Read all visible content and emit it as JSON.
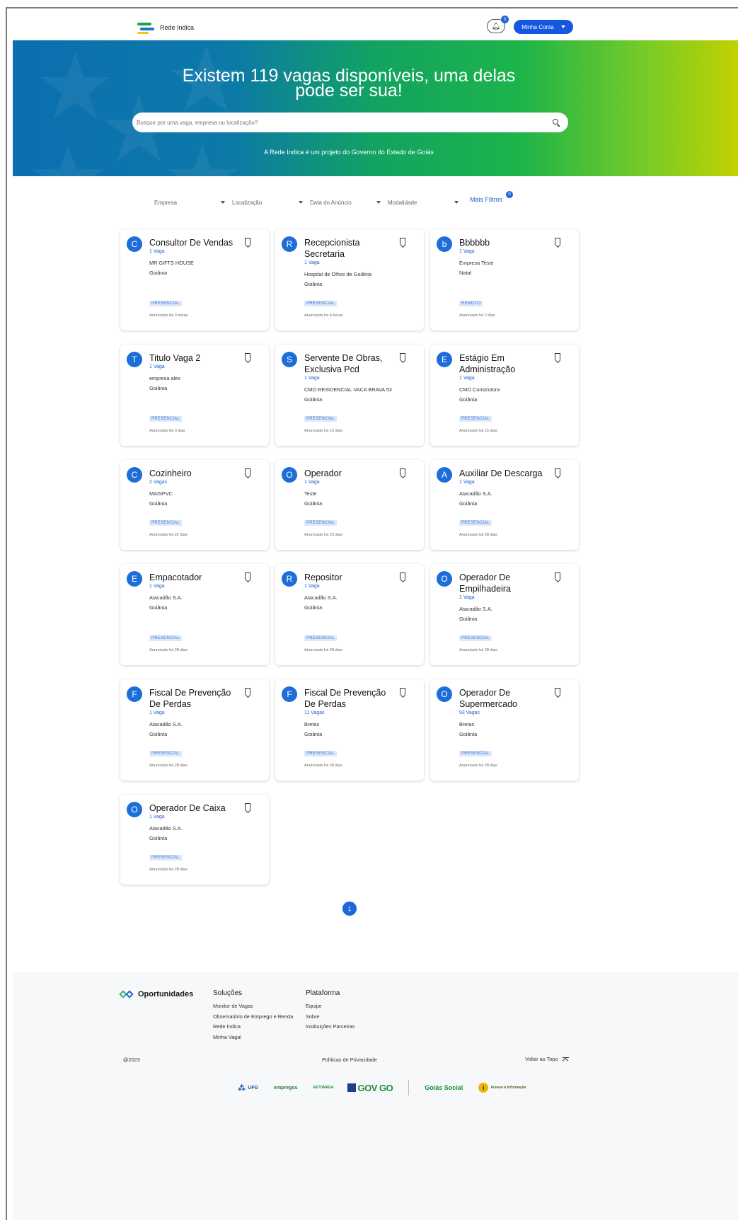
{
  "header": {
    "logo_text": "Rede Indica",
    "notif_count": "0",
    "account_label": "Minha Conta"
  },
  "hero": {
    "title_line1": "Existem 119 vagas disponíveis, uma delas",
    "title_line2": "pode ser sua!",
    "search_placeholder": "Busque por uma vaga, empresa ou localização?",
    "subtitle": "A Rede Indica é um projeto do Governo do Estado de Goiás"
  },
  "filters": {
    "items": [
      "Empresa",
      "Localização",
      "Data do Anúncio",
      "Modalidade"
    ],
    "more_label": "Mais Filtros",
    "more_count": "0"
  },
  "jobs": [
    {
      "initial": "C",
      "title": "Consultor De Vendas",
      "vagas": "1 Vaga",
      "company": "MR GIFTS HOUSE",
      "city": "Goiânia",
      "mode": "PRESENCIAL",
      "posted": "Anunciado há 3 horas"
    },
    {
      "initial": "R",
      "title": "Recepcionista Secretaria",
      "vagas": "1 Vaga",
      "company": "Hospital de Olhos de Goiânia",
      "city": "Goiânia",
      "mode": "PRESENCIAL",
      "posted": "Anunciado há 4 horas"
    },
    {
      "initial": "b",
      "title": "Bbbbbb",
      "vagas": "1 Vaga",
      "company": "Empresa Teste",
      "city": "Natal",
      "mode": "REMOTO",
      "posted": "Anunciado há 2 dias"
    },
    {
      "initial": "T",
      "title": "Titulo Vaga 2",
      "vagas": "1 Vaga",
      "company": "empresa alex",
      "city": "Goiânia",
      "mode": "PRESENCIAL",
      "posted": "Anunciado há 3 dias"
    },
    {
      "initial": "S",
      "title": "Servente De Obras, Exclusiva Pcd",
      "vagas": "1 Vaga",
      "company": "CMO RESIDENCIAL VACA BRAVA 53",
      "city": "Goiânia",
      "mode": "PRESENCIAL",
      "posted": "Anunciado há 15 dias"
    },
    {
      "initial": "E",
      "title": "Estágio Em Administração",
      "vagas": "1 Vaga",
      "company": "CMO Construtora",
      "city": "Goiânia",
      "mode": "PRESENCIAL",
      "posted": "Anunciado há 15 dias"
    },
    {
      "initial": "C",
      "title": "Cozinheiro",
      "vagas": "2 Vagas",
      "company": "MAISPVC",
      "city": "Goiânia",
      "mode": "PRESENCIAL",
      "posted": "Anunciado há 22 dias"
    },
    {
      "initial": "O",
      "title": "Operador",
      "vagas": "1 Vaga",
      "company": "Teste",
      "city": "Goiânia",
      "mode": "PRESENCIAL",
      "posted": "Anunciado há 23 dias"
    },
    {
      "initial": "A",
      "title": "Auxiliar De Descarga",
      "vagas": "1 Vaga",
      "company": "Atacadão S.A.",
      "city": "Goiânia",
      "mode": "PRESENCIAL",
      "posted": "Anunciado há 28 dias"
    },
    {
      "initial": "E",
      "title": "Empacotador",
      "vagas": "1 Vaga",
      "company": "Atacadão S.A.",
      "city": "Goiânia",
      "mode": "PRESENCIAL",
      "posted": "Anunciado há 28 dias"
    },
    {
      "initial": "R",
      "title": "Repositor",
      "vagas": "1 Vaga",
      "company": "Atacadão S.A.",
      "city": "Goiânia",
      "mode": "PRESENCIAL",
      "posted": "Anunciado há 28 dias"
    },
    {
      "initial": "O",
      "title": "Operador De Empilhadeira",
      "vagas": "1 Vaga",
      "company": "Atacadão S.A.",
      "city": "Goiânia",
      "mode": "PRESENCIAL",
      "posted": "Anunciado há 28 dias"
    },
    {
      "initial": "F",
      "title": "Fiscal De Prevenção De Perdas",
      "vagas": "1 Vaga",
      "company": "Atacadão S.A.",
      "city": "Goiânia",
      "mode": "PRESENCIAL",
      "posted": "Anunciado há 28 dias"
    },
    {
      "initial": "F",
      "title": "Fiscal De Prevenção De Perdas",
      "vagas": "11 Vagas",
      "company": "Bretas",
      "city": "Goiânia",
      "mode": "PRESENCIAL",
      "posted": "Anunciado há 28 dias"
    },
    {
      "initial": "O",
      "title": "Operador De Supermercado",
      "vagas": "93 Vagas",
      "company": "Bretas",
      "city": "Goiânia",
      "mode": "PRESENCIAL",
      "posted": "Anunciado há 28 dias"
    },
    {
      "initial": "O",
      "title": "Operador De Caixa",
      "vagas": "1 Vaga",
      "company": "Atacadão S.A.",
      "city": "Goiânia",
      "mode": "PRESENCIAL",
      "posted": "Anunciado há 28 dias"
    }
  ],
  "pagination": {
    "current": "1"
  },
  "footer": {
    "brand": "Oportunidades",
    "cols": [
      {
        "title": "Soluções",
        "links": [
          "Monitor de Vagas",
          "Observatório de Emprego e Renda",
          "Rede Indica",
          "Minha Vaga!"
        ]
      },
      {
        "title": "Plataforma",
        "links": [
          "Equipe",
          "Sobre",
          "Instituições Parceiras"
        ]
      }
    ],
    "copyright": "@2023",
    "privacy": "Políticas de Privacidade",
    "back_to_top": "Voltar ao Topo",
    "partners": {
      "ufg": "UFG",
      "empregos": "empregos",
      "retomada": "RETOMADA",
      "gov": "GOV GO",
      "goias_social": "Goiás Social",
      "acesso": "Acesso à Informação"
    }
  },
  "colors": {
    "primary": "#1f66d6",
    "tag_bg": "#dde9fb",
    "hero_start": "#0b6fb0",
    "hero_end": "#c4d100"
  }
}
